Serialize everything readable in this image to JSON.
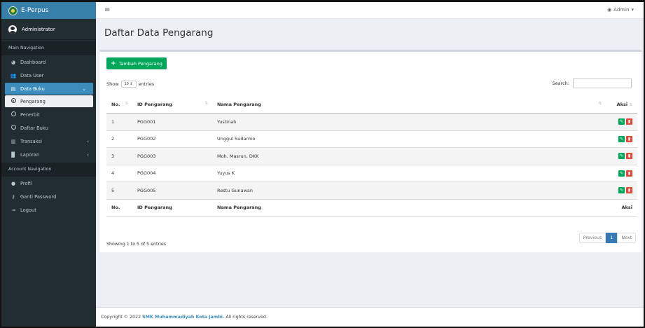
{
  "app": {
    "brand": "E-Perpus"
  },
  "user": {
    "name": "Administrator"
  },
  "topbar": {
    "admin_label": "Admin"
  },
  "sidebar": {
    "main_header": "Main Navigation",
    "account_header": "Account Navigation",
    "items": [
      {
        "label": "Dashboard",
        "icon": "dashboard-icon"
      },
      {
        "label": "Data User",
        "icon": "users-icon"
      },
      {
        "label": "Data Buku",
        "icon": "book-icon"
      },
      {
        "label": "Pengarang",
        "icon": "circle-icon"
      },
      {
        "label": "Penerbit",
        "icon": "circle-icon"
      },
      {
        "label": "Daftar Buku",
        "icon": "circle-icon"
      },
      {
        "label": "Transaksi",
        "icon": "chart-icon"
      },
      {
        "label": "Laporan",
        "icon": "file-icon"
      }
    ],
    "account_items": [
      {
        "label": "Profil",
        "icon": "user-icon"
      },
      {
        "label": "Ganti Password",
        "icon": "key-icon"
      },
      {
        "label": "Logout",
        "icon": "logout-icon"
      }
    ]
  },
  "page": {
    "title": "Daftar Data Pengarang"
  },
  "toolbar": {
    "add_label": "Tambah Pengarang"
  },
  "table_controls": {
    "show": "Show",
    "entries_value": "10",
    "entries": "entries",
    "search_label": "Search:"
  },
  "table": {
    "headers": {
      "no": "No.",
      "id": "ID Pengarang",
      "name": "Nama Pengarang",
      "action": "Aksi"
    },
    "rows": [
      {
        "no": "1",
        "id": "PGG001",
        "name": "Yustinah"
      },
      {
        "no": "2",
        "id": "PGG002",
        "name": "Unggul Sudarmo"
      },
      {
        "no": "3",
        "id": "PGG003",
        "name": "Moh. Masrun, DKK"
      },
      {
        "no": "4",
        "id": "PGG004",
        "name": "Yuyus K"
      },
      {
        "no": "5",
        "id": "PGG005",
        "name": "Restu Gunawan"
      }
    ],
    "info": "Showing 1 to 5 of 5 entries"
  },
  "pagination": {
    "previous": "Previous",
    "current": "1",
    "next": "Next"
  },
  "footer": {
    "prefix": "Copyright © 2022",
    "org": "SMK Muhammadiyah Kota Jambi.",
    "suffix": "All rights reserved."
  },
  "colors": {
    "sidebar": "#222d32",
    "brand": "#367fa9",
    "active": "#3c8dbc",
    "success": "#00a65a",
    "danger": "#dd4b39"
  }
}
